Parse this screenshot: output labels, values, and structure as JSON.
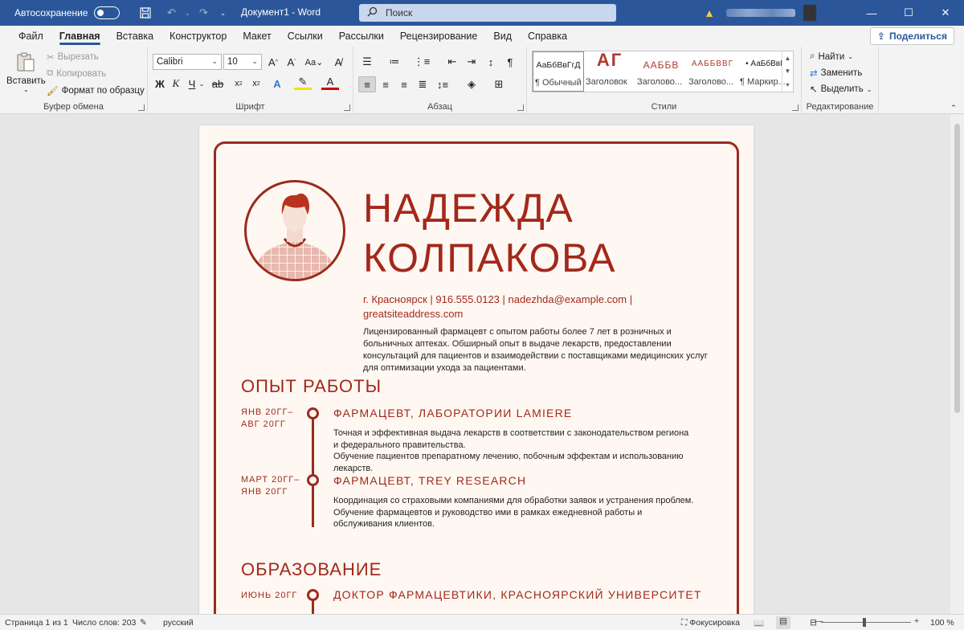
{
  "titlebar": {
    "autosave_label": "Автосохранение",
    "doc_title": "Документ1 - Word",
    "search_placeholder": "Поиск"
  },
  "tabs": [
    "Файл",
    "Главная",
    "Вставка",
    "Конструктор",
    "Макет",
    "Ссылки",
    "Рассылки",
    "Рецензирование",
    "Вид",
    "Справка"
  ],
  "share_label": "Поделиться",
  "ribbon": {
    "clipboard": {
      "label": "Буфер обмена",
      "paste": "Вставить",
      "cut": "Вырезать",
      "copy": "Копировать",
      "format_painter": "Формат по образцу"
    },
    "font": {
      "label": "Шрифт",
      "font_name": "Calibri",
      "font_size": "10"
    },
    "paragraph": {
      "label": "Абзац"
    },
    "styles": {
      "label": "Стили",
      "items": [
        {
          "preview": "АаБбВвГгД",
          "name": "¶ Обычный"
        },
        {
          "preview": "АГ",
          "name": "Заголовок"
        },
        {
          "preview": "ААББВ",
          "name": "Заголово..."
        },
        {
          "preview": "ААББВВГ",
          "name": "Заголово..."
        },
        {
          "preview": "• АаБбВвІ",
          "name": "¶ Маркир..."
        }
      ]
    },
    "editing": {
      "label": "Редактирование",
      "find": "Найти",
      "replace": "Заменить",
      "select": "Выделить"
    }
  },
  "resume": {
    "name_line1": "НАДЕЖДА",
    "name_line2": "КОЛПАКОВА",
    "contact": "г. Красноярск | 916.555.0123 | nadezhda@example.com | greatsiteaddress.com",
    "summary": "Лицензированный фармацевт с опытом работы более 7 лет в розничных и больничных аптеках. Обширный опыт в выдаче лекарств, предоставлении консультаций для пациентов и взаимодействии с поставщиками медицинских услуг для оптимизации ухода за пациентами.",
    "experience_heading": "ОПЫТ РАБОТЫ",
    "jobs": [
      {
        "dates_line1": "ЯНВ 20ГГ–",
        "dates_line2": "АВГ 20ГГ",
        "title": "ФАРМАЦЕВТ, ЛАБОРАТОРИИ LAMIERE",
        "desc_line1": "Точная и эффективная выдача лекарств в соответствии с законодательством региона и федерального правительства.",
        "desc_line2": "Обучение пациентов препаратному лечению, побочным эффектам и использованию лекарств."
      },
      {
        "dates_line1": "МАРТ 20ГГ–",
        "dates_line2": "ЯНВ 20ГГ",
        "title": "ФАРМАЦЕВТ, TREY RESEARCH",
        "desc_line1": "Координация со страховыми компаниями для обработки заявок и устранения проблем.",
        "desc_line2": "Обучение фармацевтов и руководство ими в рамках ежедневной работы и обслуживания клиентов."
      }
    ],
    "education_heading": "ОБРАЗОВАНИЕ",
    "education": [
      {
        "dates": "ИЮНЬ 20ГГ",
        "title": "ДОКТОР ФАРМАЦЕВТИКИ, КРАСНОЯРСКИЙ УНИВЕРСИТЕТ"
      }
    ]
  },
  "statusbar": {
    "page": "Страница 1 из 1",
    "words": "Число слов: 203",
    "language": "русский",
    "focus": "Фокусировка",
    "zoom": "100 %"
  },
  "colors": {
    "accent": "#2b579a",
    "resume_red": "#a3281b"
  }
}
